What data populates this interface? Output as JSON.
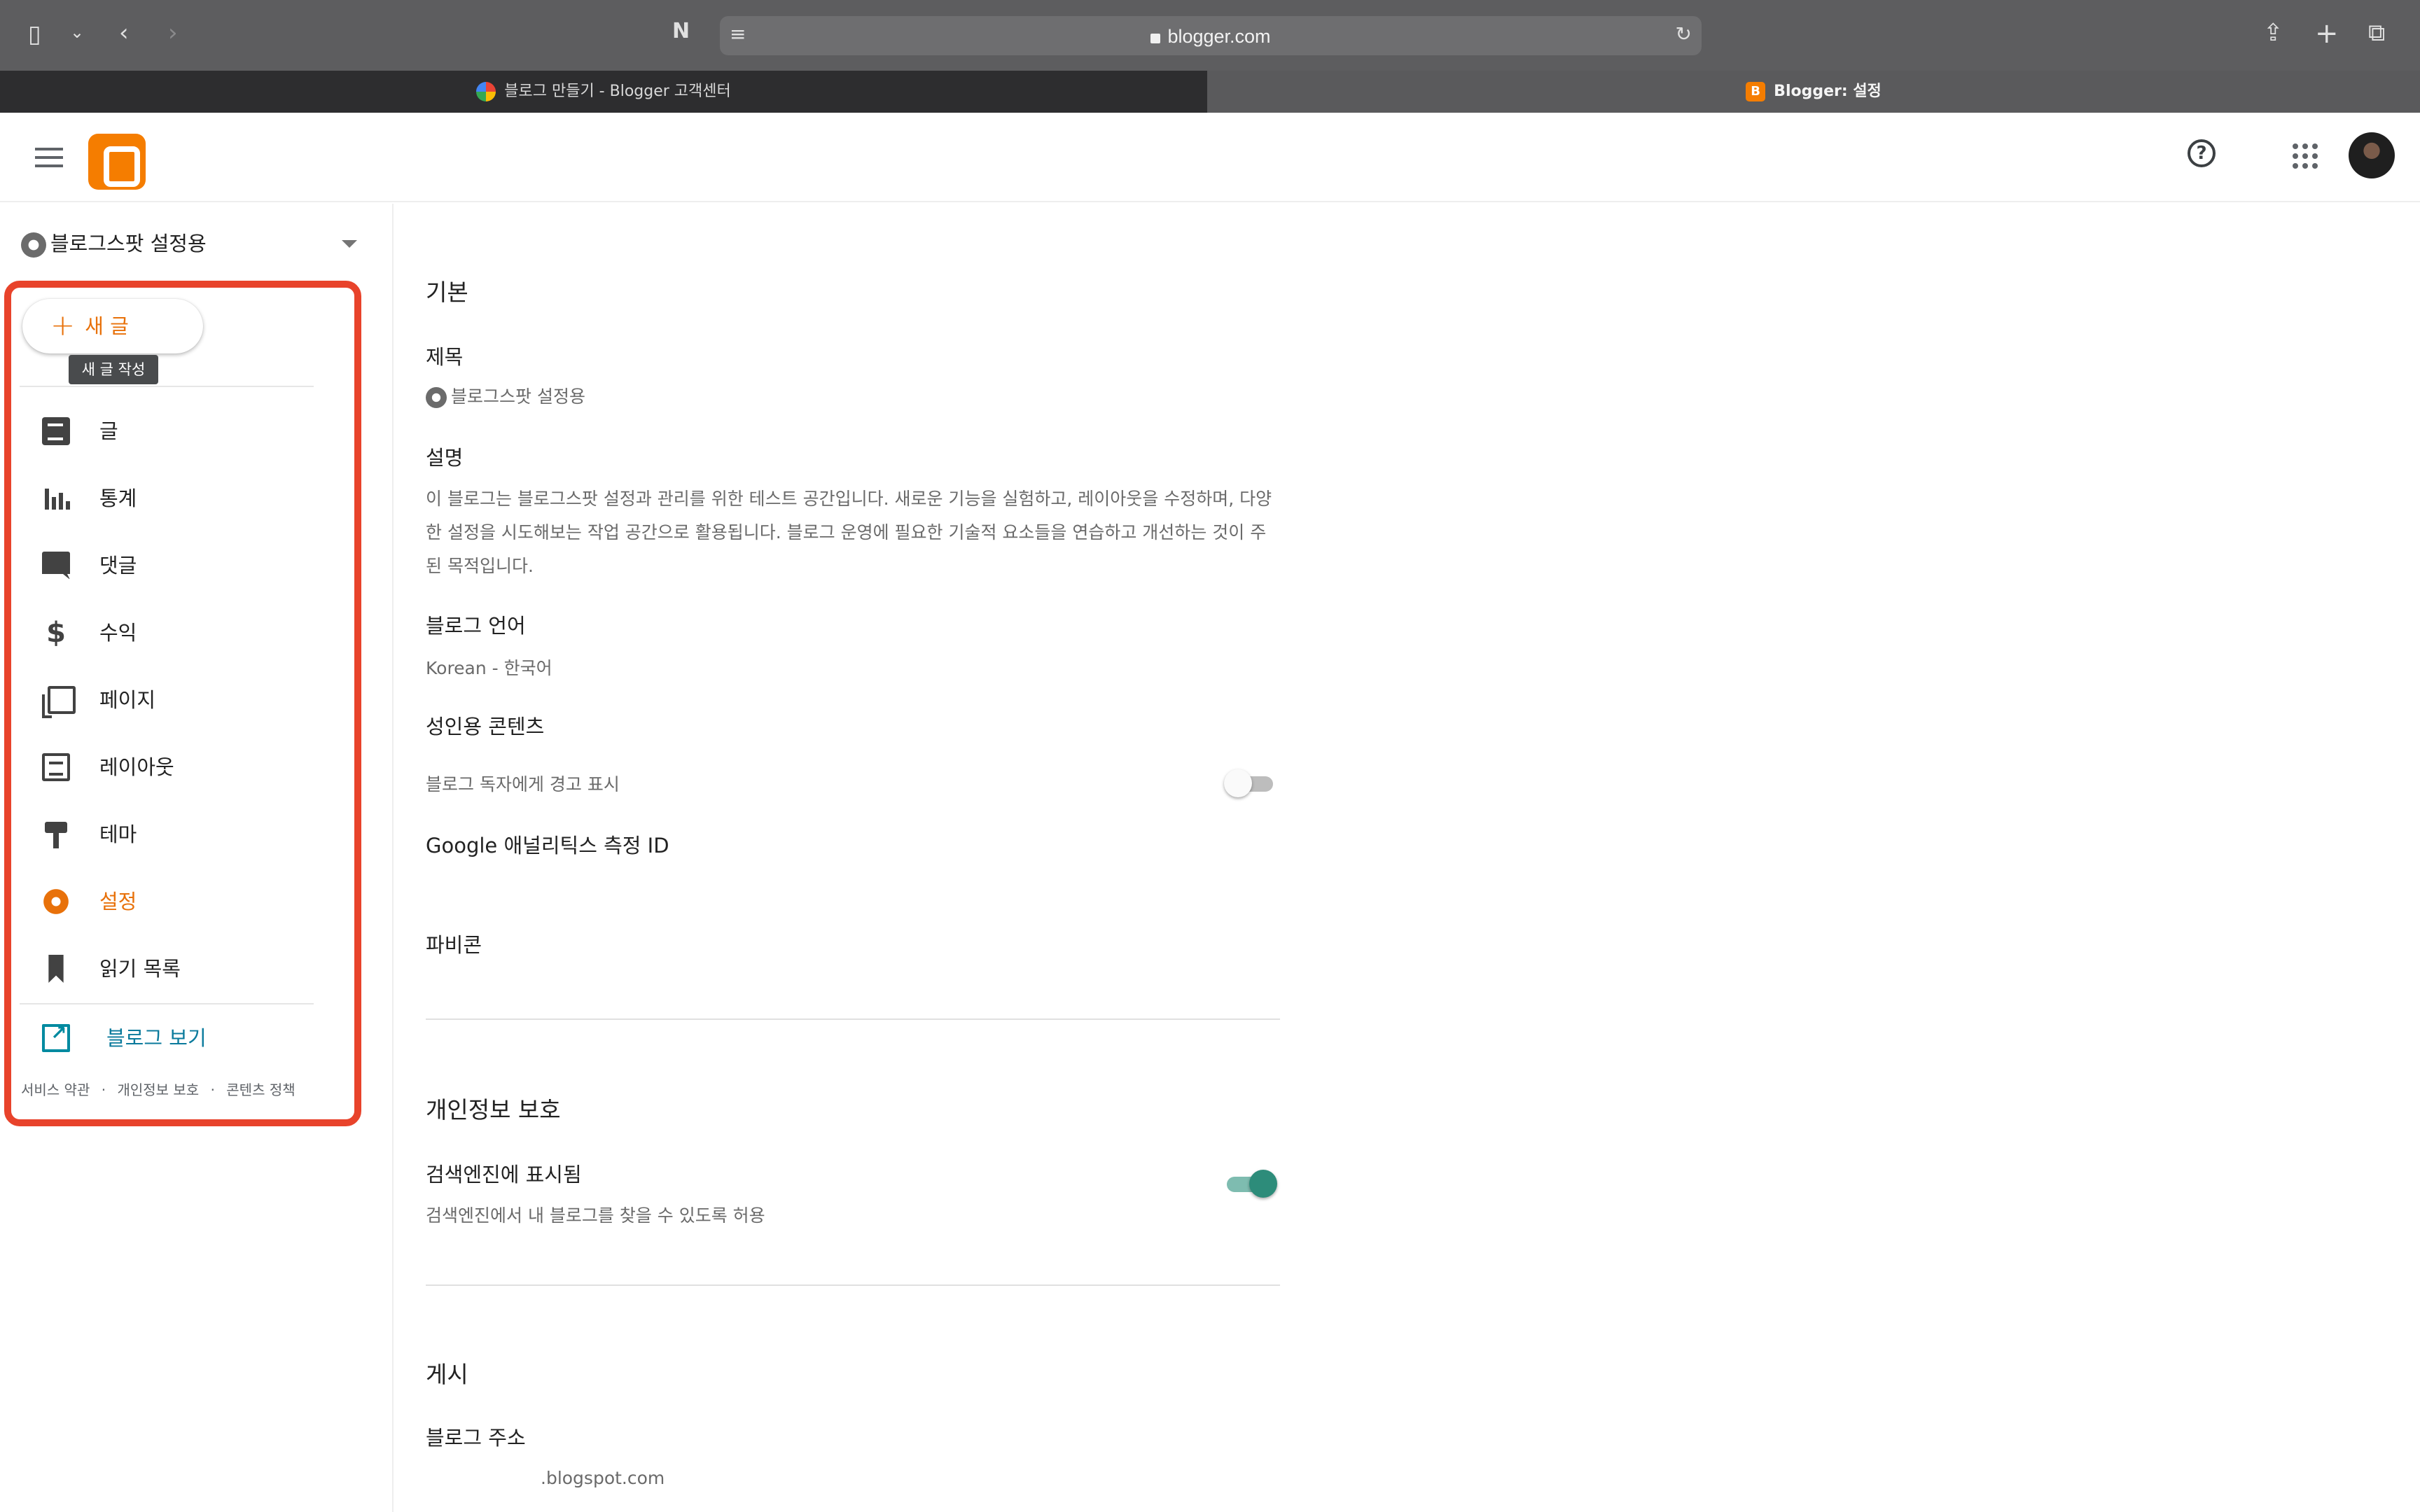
{
  "browser": {
    "url": "blogger.com",
    "tabs": [
      {
        "label": "블로그 만들기 - Blogger 고객센터",
        "favicon": "google-icon",
        "active": false
      },
      {
        "label": "Blogger: 설정",
        "favicon": "blogger-icon",
        "active": true
      }
    ]
  },
  "sidebar": {
    "blog_name": "블로그스팟 설정용",
    "new_post_label": "새 글",
    "new_post_tooltip": "새 글 작성",
    "items": [
      {
        "label": "글",
        "icon": "posts-icon"
      },
      {
        "label": "통계",
        "icon": "stats-icon"
      },
      {
        "label": "댓글",
        "icon": "comments-icon"
      },
      {
        "label": "수익",
        "icon": "earnings-icon"
      },
      {
        "label": "페이지",
        "icon": "pages-icon"
      },
      {
        "label": "레이아웃",
        "icon": "layout-icon"
      },
      {
        "label": "테마",
        "icon": "theme-icon"
      },
      {
        "label": "설정",
        "icon": "gear-icon",
        "active": true
      },
      {
        "label": "읽기 목록",
        "icon": "bookmark-icon"
      }
    ],
    "view_blog_label": "블로그 보기",
    "footer": {
      "terms": "서비스 약관",
      "privacy": "개인정보 보호",
      "content_policy": "콘텐츠 정책",
      "separator": "·"
    }
  },
  "settings": {
    "basic": {
      "section_title": "기본",
      "title_label": "제목",
      "title_value": "블로그스팟 설정용",
      "description_label": "설명",
      "description_value": "이 블로그는 블로그스팟 설정과 관리를 위한 테스트 공간입니다. 새로운 기능을 실험하고, 레이아웃을 수정하며, 다양한 설정을 시도해보는 작업 공간으로 활용됩니다. 블로그 운영에 필요한 기술적 요소들을 연습하고 개선하는 것이 주된 목적입니다.",
      "language_label": "블로그 언어",
      "language_value": "Korean - 한국어",
      "adult_label": "성인용 콘텐츠",
      "adult_toggle_label": "블로그 독자에게 경고 표시",
      "adult_toggle_on": false,
      "analytics_label": "Google 애널리틱스 측정 ID",
      "favicon_label": "파비콘"
    },
    "privacy": {
      "section_title": "개인정보 보호",
      "search_visible_label": "검색엔진에 표시됨",
      "search_visible_desc": "검색엔진에서 내 블로그를 찾을 수 있도록 허용",
      "search_visible_on": true
    },
    "publishing": {
      "section_title": "게시",
      "address_label": "블로그 주소",
      "address_value": ".blogspot.com"
    }
  },
  "colors": {
    "accent": "#e8710a",
    "highlight": "#e8432b",
    "toggle_on": "#2d8c7a",
    "link": "#0a7a9c"
  }
}
